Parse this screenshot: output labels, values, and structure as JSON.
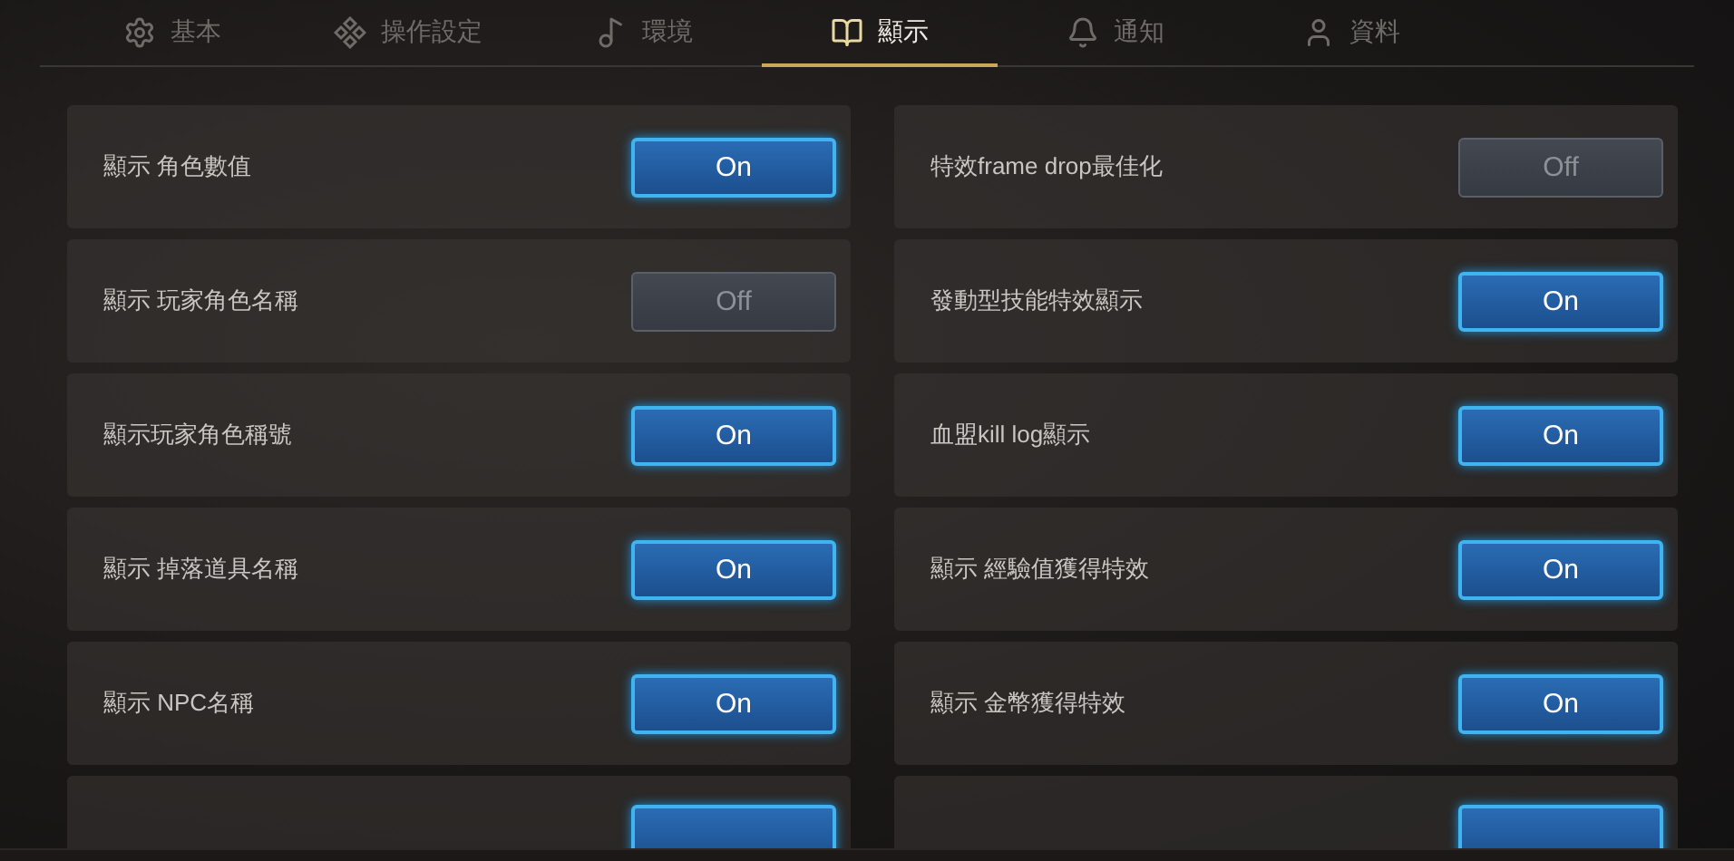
{
  "tabs": [
    {
      "label": "基本",
      "kind": "gear",
      "selected": false
    },
    {
      "label": "操作設定",
      "kind": "diamonds",
      "selected": false
    },
    {
      "label": "環境",
      "kind": "note",
      "selected": false
    },
    {
      "label": "顯示",
      "kind": "book",
      "selected": true
    },
    {
      "label": "通知",
      "kind": "bell",
      "selected": false
    },
    {
      "label": "資料",
      "kind": "user",
      "selected": false
    }
  ],
  "columns": [
    [
      {
        "label": "顯示 角色數值",
        "on": true,
        "toggle": "On"
      },
      {
        "label": "顯示 玩家角色名稱",
        "on": false,
        "toggle": "Off"
      },
      {
        "label": "顯示玩家角色稱號",
        "on": true,
        "toggle": "On"
      },
      {
        "label": "顯示 掉落道具名稱",
        "on": true,
        "toggle": "On"
      },
      {
        "label": "顯示 NPC名稱",
        "on": true,
        "toggle": "On"
      },
      {
        "kind": "partial",
        "on": true
      }
    ],
    [
      {
        "label": "特效frame drop最佳化",
        "on": false,
        "toggle": "Off"
      },
      {
        "label": "發動型技能特效顯示",
        "on": true,
        "toggle": "On"
      },
      {
        "label": "血盟kill log顯示",
        "on": true,
        "toggle": "On"
      },
      {
        "label": "顯示 經驗值獲得特效",
        "on": true,
        "toggle": "On"
      },
      {
        "label": "顯示 金幣獲得特效",
        "on": true,
        "toggle": "On"
      },
      {
        "kind": "partial",
        "on": true
      }
    ]
  ]
}
